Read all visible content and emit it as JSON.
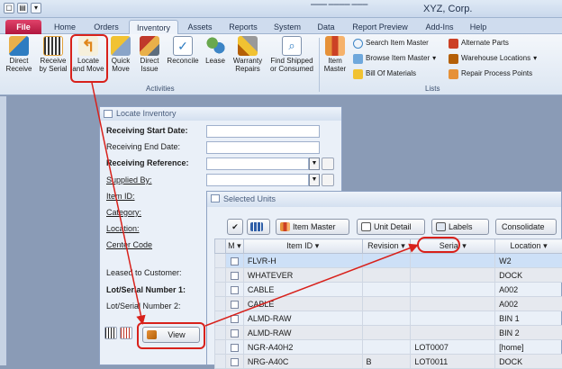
{
  "app": {
    "title": "XYZ, Corp."
  },
  "tabs": [
    {
      "label": "File"
    },
    {
      "label": "Home"
    },
    {
      "label": "Orders"
    },
    {
      "label": "Inventory"
    },
    {
      "label": "Assets"
    },
    {
      "label": "Reports"
    },
    {
      "label": "System"
    },
    {
      "label": "Data"
    },
    {
      "label": "Report Preview"
    },
    {
      "label": "Add-Ins"
    },
    {
      "label": "Help"
    }
  ],
  "ribbon": {
    "activities_group": "Activities",
    "lists_group": "Lists",
    "buttons": [
      {
        "line1": "Direct",
        "line2": "Receive"
      },
      {
        "line1": "Receive",
        "line2": "by Serial"
      },
      {
        "line1": "Locate",
        "line2": "and Move"
      },
      {
        "line1": "Quick",
        "line2": "Move"
      },
      {
        "line1": "Direct",
        "line2": "Issue"
      },
      {
        "line1": "Reconcile",
        "line2": ""
      },
      {
        "line1": "Lease",
        "line2": ""
      },
      {
        "line1": "Warranty",
        "line2": "Repairs"
      },
      {
        "line1": "Find Shipped",
        "line2": "or Consumed"
      },
      {
        "line1": "Item",
        "line2": "Master"
      }
    ],
    "lists": [
      {
        "label": "Search Item Master"
      },
      {
        "label": "Browse Item Master"
      },
      {
        "label": "Bill Of Materials"
      },
      {
        "label": "Alternate Parts"
      },
      {
        "label": "Warehouse Locations"
      },
      {
        "label": "Repair Process Points"
      }
    ]
  },
  "locate_window": {
    "title": "Locate Inventory",
    "fields": {
      "receiving_start": "Receiving Start Date:",
      "receiving_end": "Receiving End Date:",
      "receiving_ref": "Receiving Reference:",
      "supplied_by": "Supplied By:",
      "item_id": "Item ID:",
      "category": "Category:",
      "location": "Location:",
      "center_code": "Center Code",
      "leased": "Leased to Customer:",
      "lot_serial_1": "Lot/Serial Number 1:",
      "lot_serial_2": "Lot/Serial Number 2:"
    },
    "view_label": "View"
  },
  "selected_window": {
    "title": "Selected Units",
    "toolbar": {
      "item_master": "Item Master",
      "unit_detail": "Unit Detail",
      "labels": "Labels",
      "consolidate": "Consolidate"
    },
    "columns": {
      "m": "M",
      "item_id": "Item ID",
      "revision": "Revision",
      "serial": "Serial",
      "location": "Location"
    },
    "rows": [
      {
        "item_id": "FLVR-H",
        "revision": "",
        "serial": "",
        "location": "W2"
      },
      {
        "item_id": "WHATEVER",
        "revision": "",
        "serial": "",
        "location": "DOCK"
      },
      {
        "item_id": "CABLE",
        "revision": "",
        "serial": "",
        "location": "A002"
      },
      {
        "item_id": "CABLE",
        "revision": "",
        "serial": "",
        "location": "A002"
      },
      {
        "item_id": "ALMD-RAW",
        "revision": "",
        "serial": "",
        "location": "BIN 1"
      },
      {
        "item_id": "ALMD-RAW",
        "revision": "",
        "serial": "",
        "location": "BIN 2"
      },
      {
        "item_id": "NGR-A40H2",
        "revision": "",
        "serial": "LOT0007",
        "location": "[home]"
      },
      {
        "item_id": "NRG-A40C",
        "revision": "B",
        "serial": "LOT0011",
        "location": "DOCK"
      }
    ]
  },
  "colors": {
    "annotation": "#d8211b",
    "file_tab": "#c21f48",
    "accent": "#2f5fa8"
  }
}
